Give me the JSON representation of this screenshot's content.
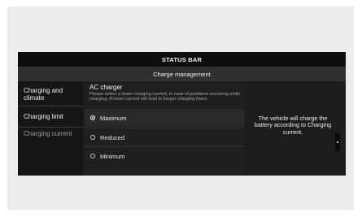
{
  "status_bar": {
    "label": "STATUS BAR"
  },
  "header": {
    "title": "Charge management"
  },
  "sidebar": {
    "items": [
      {
        "label": "Charging and climate",
        "active": true
      },
      {
        "label": "Charging limit",
        "active": true
      },
      {
        "label": "Charging current",
        "active": false
      }
    ]
  },
  "main": {
    "section_title": "AC charger",
    "description": "Please select a lower charging current, in case of problems occurring while charging. A lower current will lead to longer charging times.",
    "options": [
      {
        "label": "Maximum",
        "selected": true
      },
      {
        "label": "Reduced",
        "selected": false
      },
      {
        "label": "Minimum",
        "selected": false
      }
    ]
  },
  "info_panel": {
    "text": "The vehicle will charge the battery according to Charging current."
  },
  "colors": {
    "background": "#1e1e1e",
    "status_bar": "#0e0e0e",
    "title_bar": "#303030",
    "text": "#ffffff"
  }
}
